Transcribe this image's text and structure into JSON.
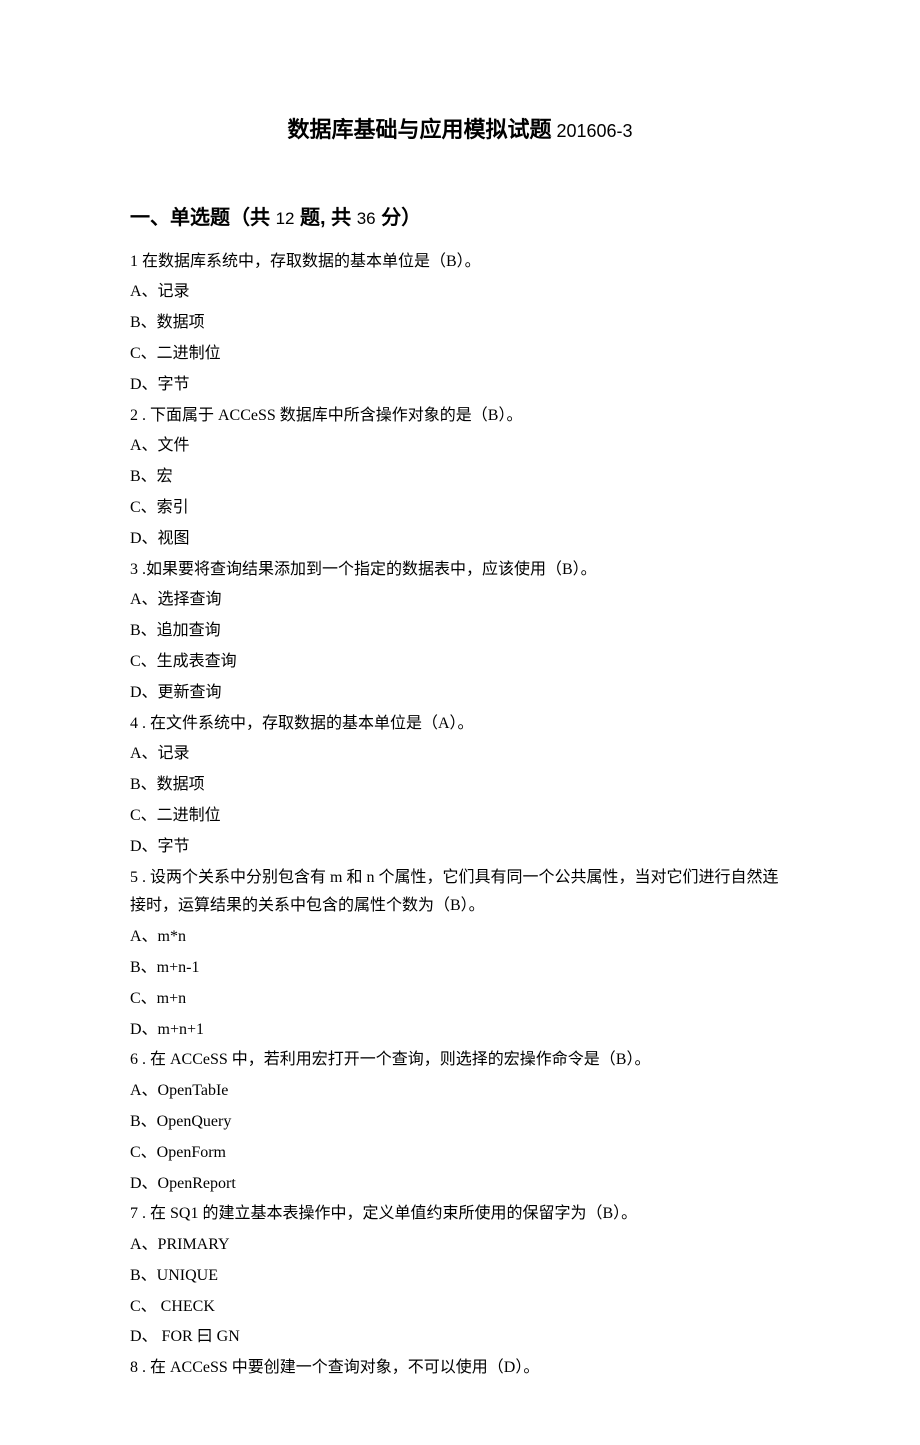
{
  "title_main": "数据库基础与应用模拟试题",
  "title_suffix": " 201606-3",
  "section1": {
    "heading_prefix": "一、单选题（共 ",
    "heading_q_count": "12",
    "heading_mid": " 题, 共 ",
    "heading_score": "36",
    "heading_suffix": " 分）"
  },
  "questions": [
    {
      "num": "1",
      "text": " 在数据库系统中，存取数据的基本单位是（B）。",
      "opts": [
        "A、记录",
        "B、数据项",
        "C、二进制位",
        "D、字节"
      ]
    },
    {
      "num": "2",
      "text": "   . 下面属于 ACCeSS 数据库中所含操作对象的是（B）。",
      "opts": [
        "A、文件",
        "B、宏",
        "C、索引",
        "D、视图"
      ]
    },
    {
      "num": "3",
      "text": "   .如果要将查询结果添加到一个指定的数据表中，应该使用（B）。",
      "opts": [
        "A、选择查询",
        "B、追加查询",
        "C、生成表查询",
        "D、更新查询"
      ]
    },
    {
      "num": "4",
      "text": "   . 在文件系统中，存取数据的基本单位是（A）。",
      "opts": [
        "A、记录",
        "B、数据项",
        "C、二进制位",
        "D、字节"
      ]
    },
    {
      "num": "5",
      "text": "   . 设两个关系中分别包含有 m 和 n 个属性，它们具有同一个公共属性，当对它们进行自然连接时，运算结果的关系中包含的属性个数为（B）。",
      "opts": [
        "A、m*n",
        "B、m+n-1",
        "C、m+n",
        "D、m+n+1"
      ]
    },
    {
      "num": "6",
      "text": "   . 在 ACCeSS 中，若利用宏打开一个查询，则选择的宏操作命令是（B）。",
      "opts": [
        "A、OpenTabIe",
        "B、OpenQuery",
        "C、OpenForm",
        "D、OpenReport"
      ]
    },
    {
      "num": "7",
      "text": "   . 在 SQ1 的建立基本表操作中，定义单值约束所使用的保留字为（B）。",
      "opts": [
        "A、PRIMARY",
        "B、UNIQUE",
        "C、 CHECK",
        "D、 FOR 曰 GN"
      ]
    },
    {
      "num": "8",
      "text": "   . 在 ACCeSS 中要创建一个查询对象，不可以使用（D）。",
      "opts": []
    }
  ]
}
